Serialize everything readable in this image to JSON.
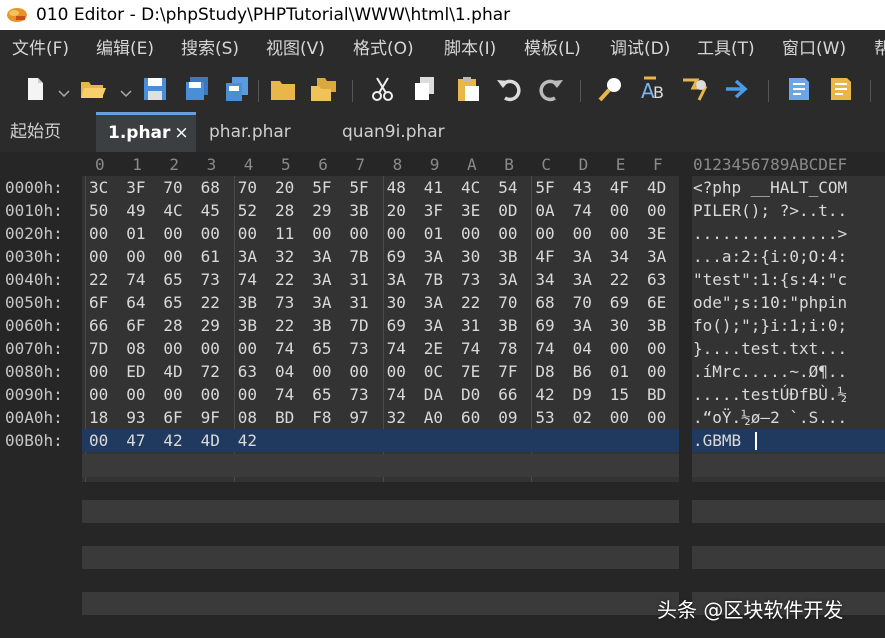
{
  "titlebar": {
    "title": "010 Editor - D:\\phpStudy\\PHPTutorial\\WWW\\html\\1.phar"
  },
  "menu": [
    "文件(F)",
    "编辑(E)",
    "搜索(S)",
    "视图(V)",
    "格式(O)",
    "脚本(I)",
    "模板(L)",
    "调试(D)",
    "工具(T)",
    "窗口(W)",
    "帮"
  ],
  "toolbar": {
    "icons": [
      "new-file-icon",
      "open-folder-icon",
      "save-icon",
      "save-all-icon",
      "copy-files-icon",
      "folder-icon",
      "open-multiple-icon",
      "cut-icon",
      "copy-icon",
      "paste-icon",
      "undo-icon",
      "redo-icon",
      "find-icon",
      "find-replace-icon",
      "goto-icon",
      "arrow-right-icon",
      "run-script-icon",
      "run-template-icon"
    ]
  },
  "tabs": [
    {
      "label": "起始页"
    },
    {
      "label": "1.phar",
      "close": "×"
    },
    {
      "label": "phar.phar"
    },
    {
      "label": "quan9i.phar"
    }
  ],
  "editor": {
    "hex_columns": [
      "0",
      "1",
      "2",
      "3",
      "4",
      "5",
      "6",
      "7",
      "8",
      "9",
      "A",
      "B",
      "C",
      "D",
      "E",
      "F"
    ],
    "ascii_header": "0123456789ABCDEF",
    "rows": [
      {
        "addr": "0000h:",
        "hex": [
          "3C",
          "3F",
          "70",
          "68",
          "70",
          "20",
          "5F",
          "5F",
          "48",
          "41",
          "4C",
          "54",
          "5F",
          "43",
          "4F",
          "4D"
        ],
        "ascii": "<?php __HALT_COM"
      },
      {
        "addr": "0010h:",
        "hex": [
          "50",
          "49",
          "4C",
          "45",
          "52",
          "28",
          "29",
          "3B",
          "20",
          "3F",
          "3E",
          "0D",
          "0A",
          "74",
          "00",
          "00"
        ],
        "ascii": "PILER(); ?>..t.."
      },
      {
        "addr": "0020h:",
        "hex": [
          "00",
          "01",
          "00",
          "00",
          "00",
          "11",
          "00",
          "00",
          "00",
          "01",
          "00",
          "00",
          "00",
          "00",
          "00",
          "3E"
        ],
        "ascii": "...............>"
      },
      {
        "addr": "0030h:",
        "hex": [
          "00",
          "00",
          "00",
          "61",
          "3A",
          "32",
          "3A",
          "7B",
          "69",
          "3A",
          "30",
          "3B",
          "4F",
          "3A",
          "34",
          "3A"
        ],
        "ascii": "...a:2:{i:0;O:4:"
      },
      {
        "addr": "0040h:",
        "hex": [
          "22",
          "74",
          "65",
          "73",
          "74",
          "22",
          "3A",
          "31",
          "3A",
          "7B",
          "73",
          "3A",
          "34",
          "3A",
          "22",
          "63"
        ],
        "ascii": "\"test\":1:{s:4:\"c"
      },
      {
        "addr": "0050h:",
        "hex": [
          "6F",
          "64",
          "65",
          "22",
          "3B",
          "73",
          "3A",
          "31",
          "30",
          "3A",
          "22",
          "70",
          "68",
          "70",
          "69",
          "6E"
        ],
        "ascii": "ode\";s:10:\"phpin"
      },
      {
        "addr": "0060h:",
        "hex": [
          "66",
          "6F",
          "28",
          "29",
          "3B",
          "22",
          "3B",
          "7D",
          "69",
          "3A",
          "31",
          "3B",
          "69",
          "3A",
          "30",
          "3B"
        ],
        "ascii": "fo();\";}i:1;i:0;"
      },
      {
        "addr": "0070h:",
        "hex": [
          "7D",
          "08",
          "00",
          "00",
          "00",
          "74",
          "65",
          "73",
          "74",
          "2E",
          "74",
          "78",
          "74",
          "04",
          "00",
          "00"
        ],
        "ascii": "}....test.txt..."
      },
      {
        "addr": "0080h:",
        "hex": [
          "00",
          "ED",
          "4D",
          "72",
          "63",
          "04",
          "00",
          "00",
          "00",
          "0C",
          "7E",
          "7F",
          "D8",
          "B6",
          "01",
          "00"
        ],
        "ascii": ".íMrc.....~.Ø¶.."
      },
      {
        "addr": "0090h:",
        "hex": [
          "00",
          "00",
          "00",
          "00",
          "00",
          "74",
          "65",
          "73",
          "74",
          "DA",
          "D0",
          "66",
          "42",
          "D9",
          "15",
          "BD"
        ],
        "ascii": ".....testÚÐfBÙ.½"
      },
      {
        "addr": "00A0h:",
        "hex": [
          "18",
          "93",
          "6F",
          "9F",
          "08",
          "BD",
          "F8",
          "97",
          "32",
          "A0",
          "60",
          "09",
          "53",
          "02",
          "00",
          "00"
        ],
        "ascii": ".“oŸ.½ø—2 `.S..."
      },
      {
        "addr": "00B0h:",
        "hex": [
          "00",
          "47",
          "42",
          "4D",
          "42"
        ],
        "ascii": ".GBMB"
      }
    ]
  },
  "watermark": "头条 @区块软件开发"
}
